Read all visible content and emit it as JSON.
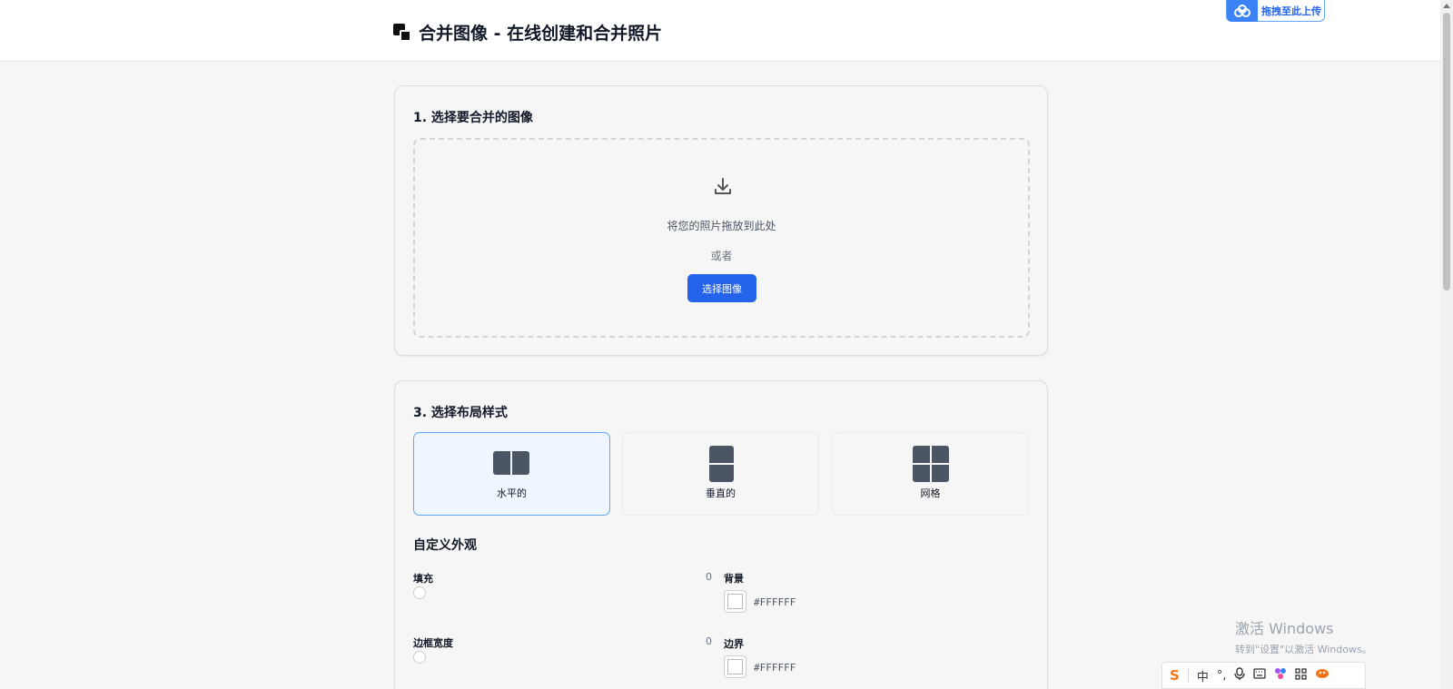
{
  "header": {
    "title": "合并图像 - 在线创建和合并照片",
    "upload_badge": "拖拽至此上传"
  },
  "step1": {
    "heading": "1. 选择要合并的图像",
    "drop_text": "将您的照片拖放到此处",
    "or_text": "或者",
    "select_button": "选择图像"
  },
  "step3": {
    "heading": "3. 选择布局样式",
    "layouts": [
      {
        "label": "水平的",
        "selected": true
      },
      {
        "label": "垂直的",
        "selected": false
      },
      {
        "label": "网格",
        "selected": false
      }
    ],
    "customize_title": "自定义外观",
    "padding": {
      "label": "填充",
      "value": "0"
    },
    "border_width": {
      "label": "边框宽度",
      "value": "0"
    },
    "background": {
      "label": "背景",
      "hex": "#FFFFFF"
    },
    "border_color": {
      "label": "边界",
      "hex": "#FFFFFF"
    }
  },
  "watermark": {
    "line1": "激活 Windows",
    "line2": "转到\"设置\"以激活 Windows。"
  },
  "ime": {
    "logo": "S",
    "mode": "中",
    "punct": "°,"
  },
  "colors": {
    "accent": "#2563eb",
    "selected_border": "#60a5fa",
    "selected_bg": "#eff6ff"
  }
}
